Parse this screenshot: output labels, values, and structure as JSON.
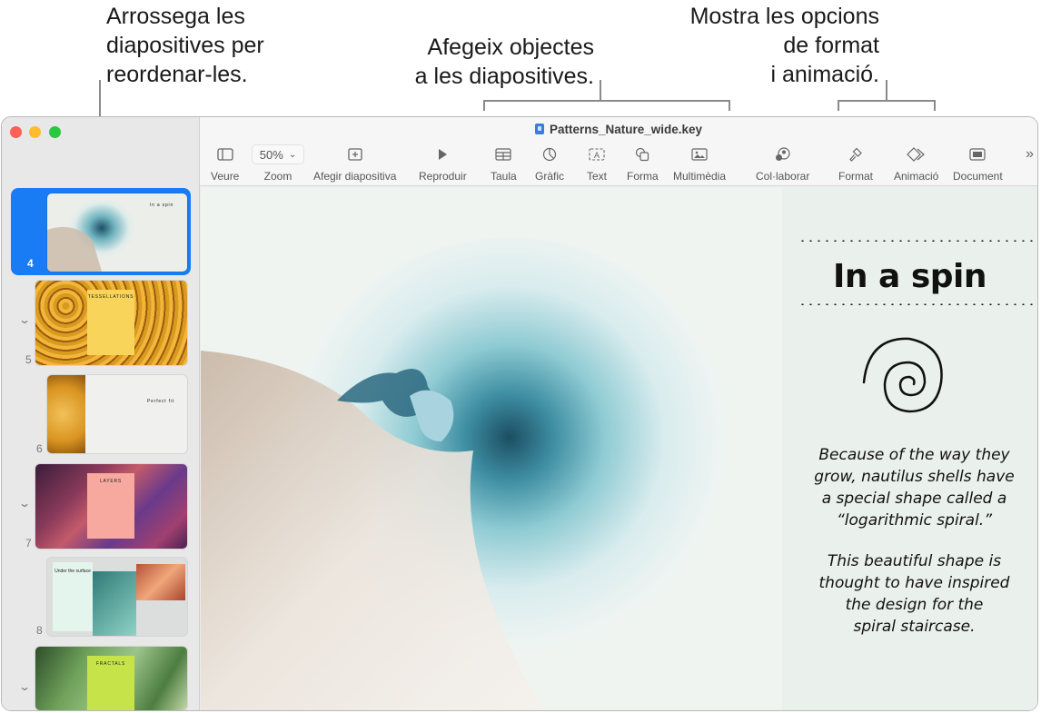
{
  "callouts": {
    "left": [
      "Arrossega les",
      "diapositives per",
      "reordenar-les."
    ],
    "middle": [
      "Afegeix objectes",
      "a les diapositives."
    ],
    "right": [
      "Mostra les opcions",
      "de format",
      "i animació."
    ]
  },
  "window": {
    "title": "Patterns_Nature_wide.key",
    "title_icon": "keynote-file-icon"
  },
  "toolbar": {
    "zoom_value": "50%",
    "items": [
      {
        "id": "view",
        "label": "Veure",
        "icon": "sidebar-view-icon"
      },
      {
        "id": "zoom",
        "label": "Zoom",
        "icon": "zoom-dropdown"
      },
      {
        "id": "add-slide",
        "label": "Afegir diapositiva",
        "icon": "plus-square-icon"
      },
      {
        "id": "play",
        "label": "Reproduir",
        "icon": "play-icon"
      },
      {
        "id": "table",
        "label": "Taula",
        "icon": "table-icon"
      },
      {
        "id": "chart",
        "label": "Gràfic",
        "icon": "chart-icon"
      },
      {
        "id": "text",
        "label": "Text",
        "icon": "text-box-icon"
      },
      {
        "id": "shape",
        "label": "Forma",
        "icon": "shape-icon"
      },
      {
        "id": "media",
        "label": "Multimèdia",
        "icon": "photo-icon"
      },
      {
        "id": "collaborate",
        "label": "Col·laborar",
        "icon": "collaborate-icon"
      },
      {
        "id": "format",
        "label": "Format",
        "icon": "paintbrush-icon"
      },
      {
        "id": "animate",
        "label": "Animació",
        "icon": "animate-diamond-icon"
      },
      {
        "id": "document",
        "label": "Document",
        "icon": "document-icon"
      }
    ],
    "more": "»"
  },
  "navigator": {
    "slides": [
      {
        "number": "4",
        "selected": true,
        "heading": "In a spin"
      },
      {
        "number": "5",
        "selected": false,
        "heading": "TESSELLATIONS",
        "collapsible": true
      },
      {
        "number": "6",
        "selected": false,
        "heading": "Perfect fit"
      },
      {
        "number": "7",
        "selected": false,
        "heading": "LAYERS",
        "collapsible": true
      },
      {
        "number": "8",
        "selected": false,
        "heading": "Under the surface"
      },
      {
        "number": "",
        "selected": false,
        "heading": "FRACTALS",
        "collapsible": true
      }
    ]
  },
  "slide": {
    "title": "In a spin",
    "paragraph1": [
      "Because of the way they",
      "grow, nautilus shells have",
      "a special shape called a",
      "“logarithmic spiral.”"
    ],
    "paragraph2": [
      "This beautiful shape is",
      "thought to have inspired",
      "the design for the",
      "spiral staircase."
    ]
  }
}
